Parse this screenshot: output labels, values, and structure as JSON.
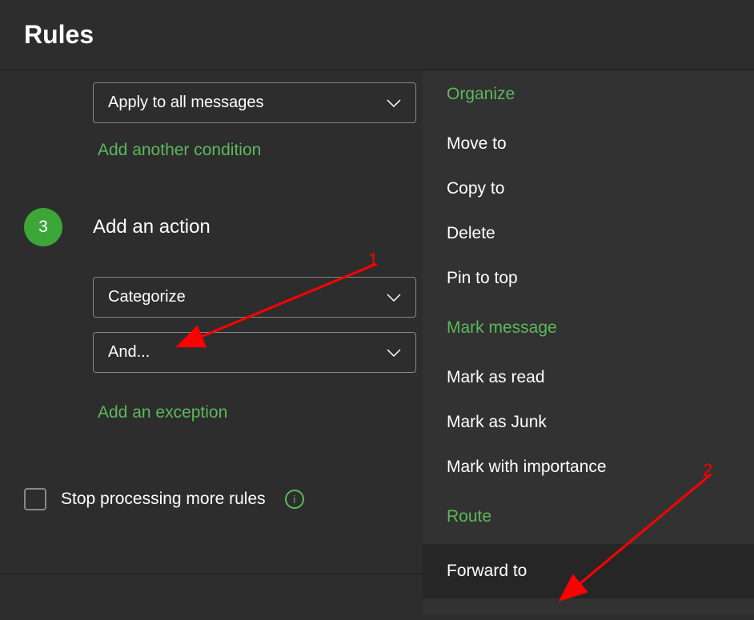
{
  "header": {
    "title": "Rules"
  },
  "condition": {
    "selected": "Apply to all messages",
    "add_link": "Add another condition"
  },
  "action": {
    "step_number": "3",
    "title": "Add an action",
    "dropdown1": "Categorize",
    "dropdown2": "And...",
    "exception_link": "Add an exception"
  },
  "stop_processing": {
    "label": "Stop processing more rules"
  },
  "menu": {
    "section1_header": "Organize",
    "section1_items": [
      "Move to",
      "Copy to",
      "Delete",
      "Pin to top"
    ],
    "section2_header": "Mark message",
    "section2_items": [
      "Mark as read",
      "Mark as Junk",
      "Mark with importance"
    ],
    "section3_header": "Route",
    "section3_items": [
      "Forward to"
    ]
  },
  "annotations": {
    "label1": "1",
    "label2": "2"
  }
}
